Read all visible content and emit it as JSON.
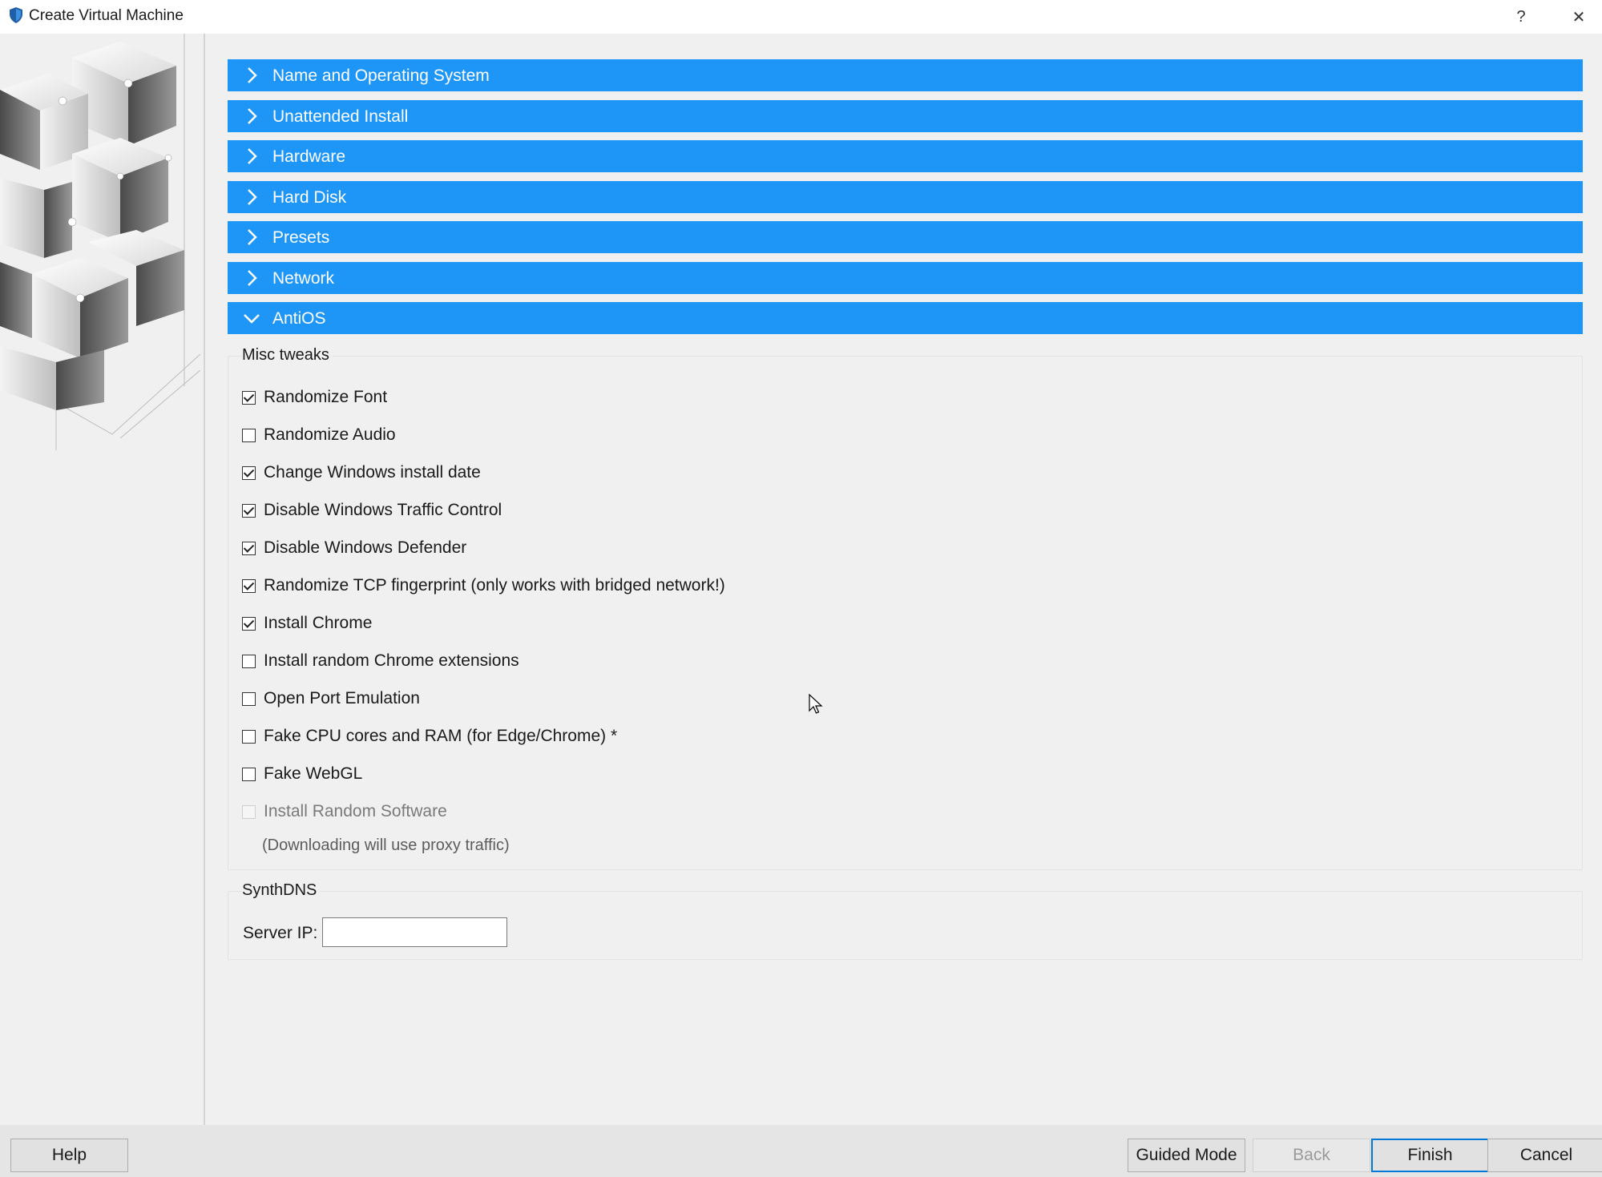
{
  "window": {
    "title": "Create Virtual Machine",
    "help_glyph": "?",
    "close_glyph": "✕"
  },
  "sections": [
    {
      "label": "Name and Operating System",
      "expanded": false
    },
    {
      "label": "Unattended Install",
      "expanded": false
    },
    {
      "label": "Hardware",
      "expanded": false
    },
    {
      "label": "Hard Disk",
      "expanded": false
    },
    {
      "label": "Presets",
      "expanded": false
    },
    {
      "label": "Network",
      "expanded": false
    },
    {
      "label": "AntiOS",
      "expanded": true
    }
  ],
  "misc_tweaks": {
    "title": "Misc tweaks",
    "options": [
      {
        "label": "Randomize Font",
        "checked": true,
        "enabled": true
      },
      {
        "label": "Randomize Audio",
        "checked": false,
        "enabled": true
      },
      {
        "label": "Change Windows install date",
        "checked": true,
        "enabled": true
      },
      {
        "label": "Disable Windows Traffic Control",
        "checked": true,
        "enabled": true
      },
      {
        "label": "Disable Windows Defender",
        "checked": true,
        "enabled": true
      },
      {
        "label": "Randomize TCP fingerprint (only works with bridged network!)",
        "checked": true,
        "enabled": true
      },
      {
        "label": "Install Chrome",
        "checked": true,
        "enabled": true
      },
      {
        "label": "Install random Chrome extensions",
        "checked": false,
        "enabled": true
      },
      {
        "label": "Open Port Emulation",
        "checked": false,
        "enabled": true
      },
      {
        "label": "Fake CPU cores and RAM (for Edge/Chrome) *",
        "checked": false,
        "enabled": true
      },
      {
        "label": "Fake WebGL",
        "checked": false,
        "enabled": true
      },
      {
        "label": "Install Random Software",
        "checked": false,
        "enabled": false
      }
    ],
    "note": "(Downloading will use proxy traffic)"
  },
  "synthdns": {
    "title": "SynthDNS",
    "server_ip_label": "Server IP:",
    "server_ip_value": ""
  },
  "buttons": {
    "help": "Help",
    "guided_mode": "Guided Mode",
    "back": "Back",
    "finish": "Finish",
    "cancel": "Cancel"
  },
  "colors": {
    "section_header": "#1e96f8",
    "accent_border": "#0078d7"
  }
}
